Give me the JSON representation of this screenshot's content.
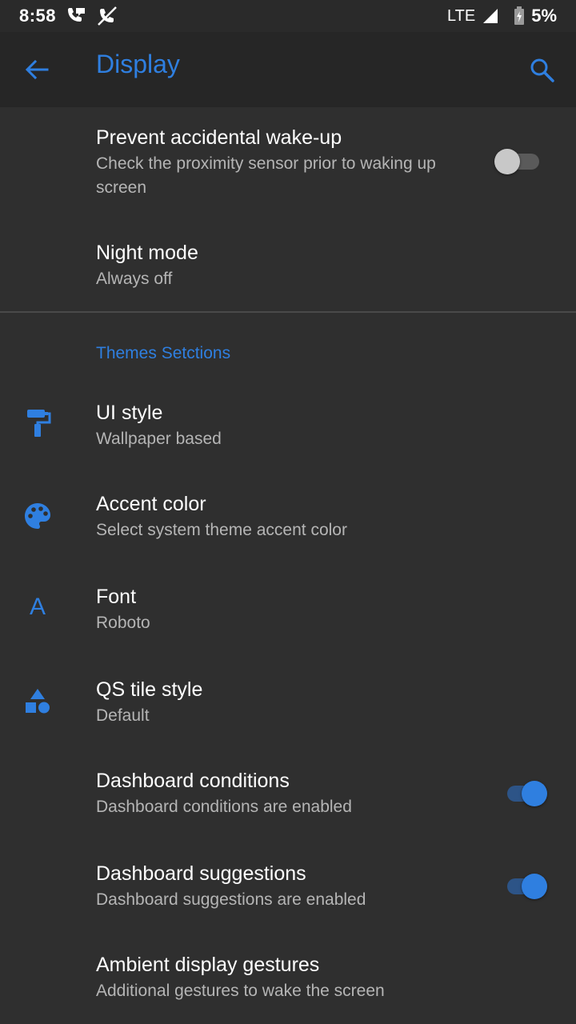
{
  "status_bar": {
    "time": "8:58",
    "network": "LTE",
    "battery": "5%"
  },
  "app_bar": {
    "title": "Display"
  },
  "items": {
    "wake": {
      "title": "Prevent accidental wake-up",
      "summary": "Check the proximity sensor prior to waking up screen",
      "switch_on": false
    },
    "night": {
      "title": "Night mode",
      "summary": "Always off"
    },
    "section_header": "Themes Setctions",
    "ui_style": {
      "title": "UI style",
      "summary": "Wallpaper based",
      "icon": "paint-roller-icon"
    },
    "accent": {
      "title": "Accent color",
      "summary": "Select system theme accent color",
      "icon": "palette-icon"
    },
    "font": {
      "title": "Font",
      "summary": "Roboto",
      "icon": "font-icon",
      "icon_glyph": "A"
    },
    "qs_tile": {
      "title": "QS tile style",
      "summary": "Default",
      "icon": "shapes-icon"
    },
    "dash_conditions": {
      "title": "Dashboard conditions",
      "summary": "Dashboard conditions are enabled",
      "switch_on": true
    },
    "dash_suggestions": {
      "title": "Dashboard suggestions",
      "summary": "Dashboard suggestions are enabled",
      "switch_on": true
    },
    "ambient": {
      "title": "Ambient display gestures",
      "summary": "Additional gestures to wake the screen"
    }
  },
  "colors": {
    "accent": "#2f7fe0",
    "background": "#2f2f2f",
    "app_bar": "#262626",
    "status_bar": "#2a2a2a"
  }
}
